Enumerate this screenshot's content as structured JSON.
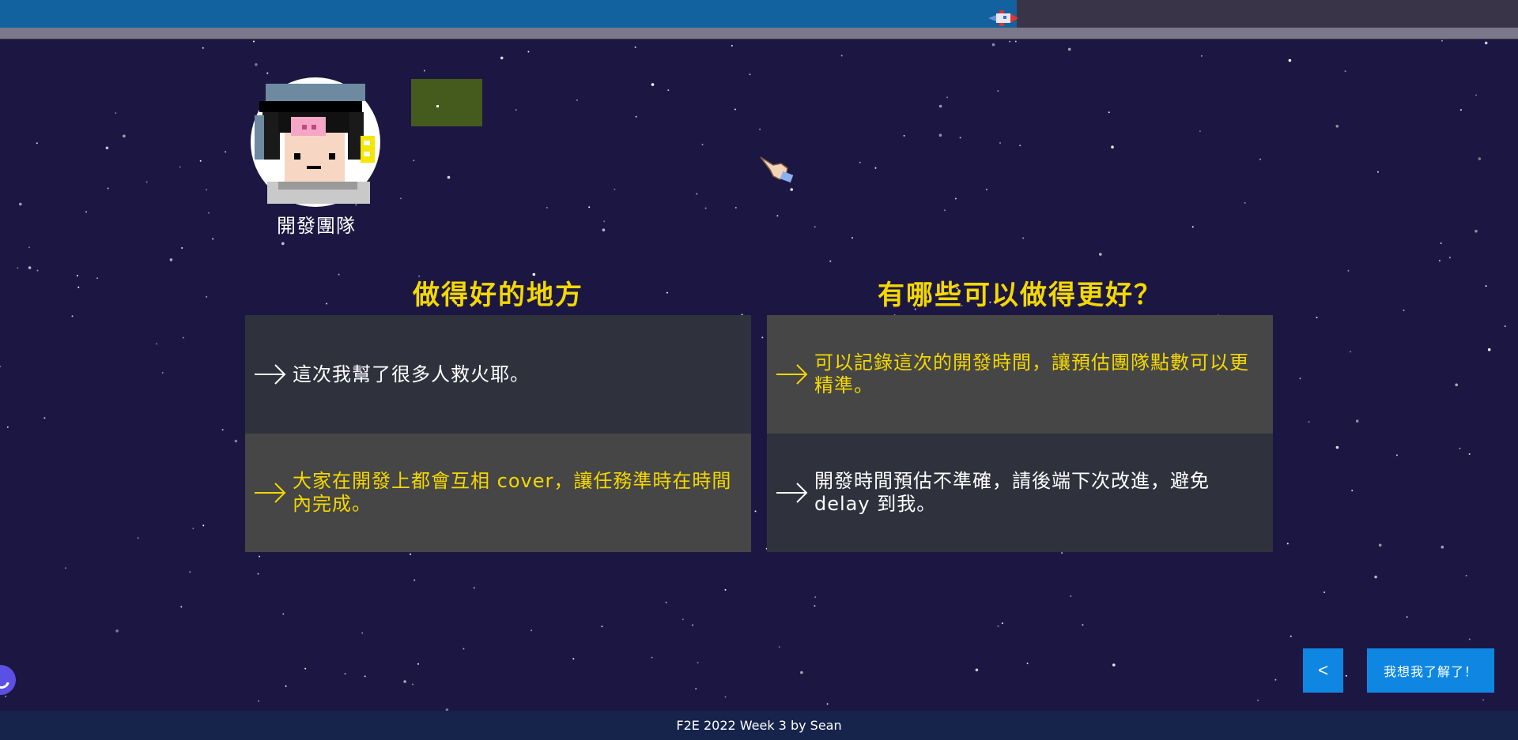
{
  "progress": {
    "fraction": 0.67
  },
  "team": {
    "label": "開發團隊",
    "avatar_icon": "astronaut-pixel-avatar-icon"
  },
  "columns": [
    {
      "title": "做得好的地方",
      "cards": [
        {
          "text": "這次我幫了很多人救火耶。",
          "color": "white",
          "bg": "dark"
        },
        {
          "text": "大家在開發上都會互相 cover，讓任務準時在時間內完成。",
          "color": "yellow",
          "bg": "gray"
        }
      ]
    },
    {
      "title": "有哪些可以做得更好？",
      "cards": [
        {
          "text": "可以記錄這次的開發時間，讓預估團隊點數可以更精準。",
          "color": "yellow",
          "bg": "gray"
        },
        {
          "text": "開發時間預估不準確，請後端下次改進，避免 delay 到我。",
          "color": "white",
          "bg": "dark"
        }
      ]
    }
  ],
  "nav": {
    "back_label": "<",
    "next_label": "我想我了解了！"
  },
  "footer": {
    "text": "F2E 2022 Week 3 by Sean"
  },
  "colors": {
    "background": "#1c1742",
    "accent_yellow": "#f4d800",
    "button_blue": "#0f87e2",
    "progress_blue": "#1362a0"
  },
  "icons": [
    "rocket-icon",
    "astronaut-pixel-avatar-icon",
    "pointing-hand-cursor-icon",
    "arrow-right-icon",
    "chevron-left-icon",
    "loading-icon"
  ]
}
